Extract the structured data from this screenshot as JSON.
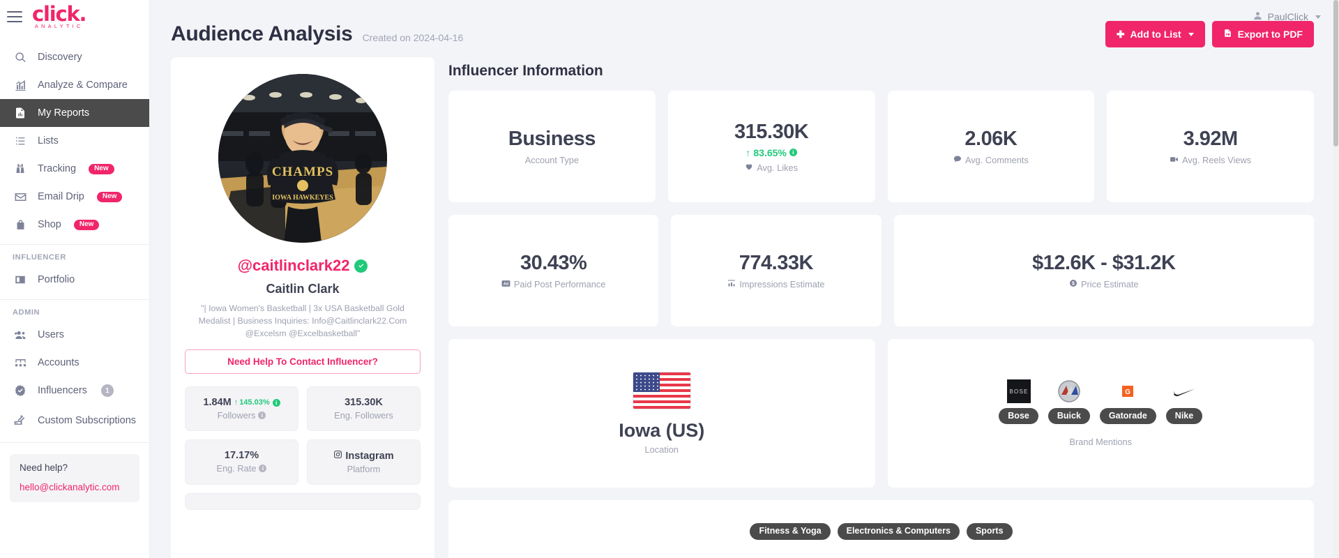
{
  "brand": {
    "name": "click.",
    "tagline": "ANALYTIC"
  },
  "topbar": {
    "user": "PaulClick"
  },
  "sidebar": {
    "items": [
      {
        "label": "Discovery",
        "icon": "search-icon",
        "active": false
      },
      {
        "label": "Analyze & Compare",
        "icon": "chart-icon",
        "active": false
      },
      {
        "label": "My Reports",
        "icon": "report-icon",
        "active": true
      },
      {
        "label": "Lists",
        "icon": "list-icon",
        "active": false
      },
      {
        "label": "Tracking",
        "icon": "binoculars-icon",
        "badge": "New"
      },
      {
        "label": "Email Drip",
        "icon": "envelope-icon",
        "badge": "New"
      },
      {
        "label": "Shop",
        "icon": "bag-icon",
        "badge": "New"
      }
    ],
    "influencer_heading": "INFLUENCER",
    "influencer_items": [
      {
        "label": "Portfolio",
        "icon": "id-card-icon"
      }
    ],
    "admin_heading": "ADMIN",
    "admin_items": [
      {
        "label": "Users",
        "icon": "users-icon"
      },
      {
        "label": "Accounts",
        "icon": "accounts-icon"
      },
      {
        "label": "Influencers",
        "icon": "verified-badge-icon",
        "count": "1"
      },
      {
        "label": "Custom Subscriptions",
        "icon": "money-icon"
      }
    ],
    "help": {
      "title": "Need help?",
      "email": "hello@clickanalytic.com"
    }
  },
  "header": {
    "title": "Audience Analysis",
    "created": "Created on 2024-04-16",
    "add_to_list": "Add to List",
    "export_pdf": "Export to PDF"
  },
  "profile": {
    "handle": "@caitlinclark22",
    "name": "Caitlin Clark",
    "bio": "\"| Iowa Women's Basketball | 3x USA Basketball Gold Medalist | Business Inquiries: Info@Caitlinclark22.Com @Excelsm @Excelbasketball\"",
    "contact_btn": "Need Help To Contact Influencer?",
    "tiles": [
      {
        "value": "1.84M",
        "delta": "145.03%",
        "label": "Followers",
        "info": true
      },
      {
        "value": "315.30K",
        "label": "Eng. Followers"
      },
      {
        "value": "17.17%",
        "label": "Eng. Rate",
        "info": true
      },
      {
        "value": "Instagram",
        "label": "Platform",
        "icon": "instagram-icon"
      }
    ]
  },
  "main": {
    "section_title": "Influencer Information",
    "stats_row1": [
      {
        "value": "Business",
        "label": "Account Type"
      },
      {
        "value": "315.30K",
        "delta": "83.65%",
        "label": "Avg. Likes",
        "icon": "heart-icon"
      },
      {
        "value": "2.06K",
        "label": "Avg. Comments",
        "icon": "comment-icon"
      },
      {
        "value": "3.92M",
        "label": "Avg. Reels Views",
        "icon": "video-icon"
      }
    ],
    "stats_row2": [
      {
        "value": "30.43%",
        "label": "Paid Post Performance",
        "icon": "ad-icon"
      },
      {
        "value": "774.33K",
        "label": "Impressions Estimate",
        "icon": "impressions-icon"
      },
      {
        "value": "$12.6K - $31.2K",
        "label": "Price Estimate",
        "icon": "dollar-icon"
      }
    ],
    "location": {
      "value": "Iowa (US)",
      "label": "Location",
      "flag": "us-flag-icon"
    },
    "brands": {
      "caption": "Brand Mentions",
      "items": [
        {
          "name": "Bose",
          "logo": "bose-logo"
        },
        {
          "name": "Buick",
          "logo": "buick-logo"
        },
        {
          "name": "Gatorade",
          "logo": "gatorade-logo"
        },
        {
          "name": "Nike",
          "logo": "nike-logo"
        }
      ]
    },
    "tags": [
      "Fitness & Yoga",
      "Electronics & Computers",
      "Sports"
    ]
  },
  "colors": {
    "accent": "#f0256a",
    "positive": "#21c97a",
    "dark": "#4b4b4b"
  }
}
